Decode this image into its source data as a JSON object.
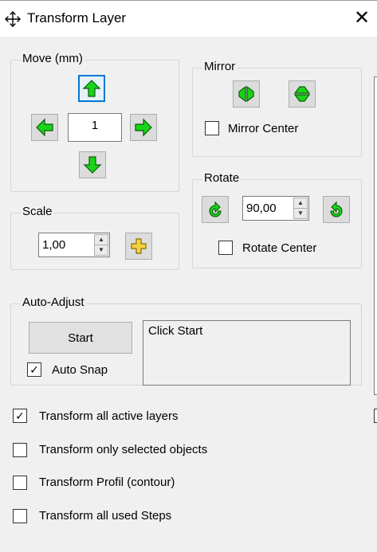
{
  "window": {
    "title": "Transform Layer",
    "close_symbol": "✕"
  },
  "move": {
    "label": "Move (mm)",
    "value": "1"
  },
  "mirror": {
    "label": "Mirror",
    "center_label": "Mirror Center",
    "center_checked": false
  },
  "scale": {
    "label": "Scale",
    "value": "1,00"
  },
  "rotate": {
    "label": "Rotate",
    "value": "90,00",
    "center_label": "Rotate Center",
    "center_checked": false
  },
  "auto_adjust": {
    "label": "Auto-Adjust",
    "start_label": "Start",
    "status": "Click Start",
    "snap_label": "Auto Snap",
    "snap_checked": true
  },
  "options": [
    {
      "label": "Transform all active layers",
      "checked": true
    },
    {
      "label": "Transform only selected objects",
      "checked": false
    },
    {
      "label": "Transform Profil (contour)",
      "checked": false
    },
    {
      "label": "Transform all used Steps",
      "checked": false
    }
  ],
  "colors": {
    "arrow_green": "#19d419",
    "arrow_outline": "#0a5a0a",
    "plus_yellow": "#f5d142",
    "focus_blue": "#0078d7"
  }
}
